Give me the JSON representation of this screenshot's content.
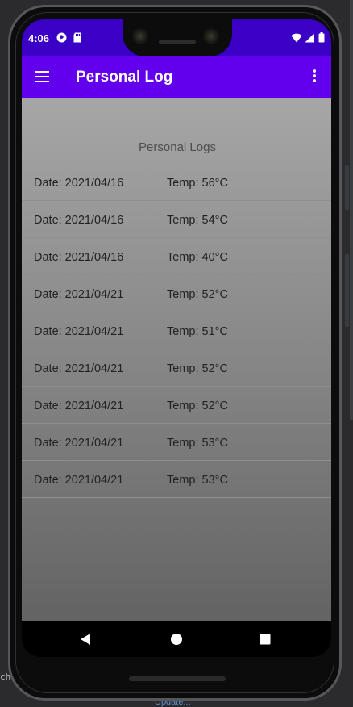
{
  "status_bar": {
    "time": "4:06",
    "left_icons": [
      "app-notification-icon",
      "sd-card-icon"
    ],
    "right_icons": [
      "wifi-icon",
      "cell-signal-icon",
      "battery-icon"
    ],
    "color": "#3a00c6"
  },
  "app_bar": {
    "title": "Personal Log",
    "color": "#6200ee",
    "menu_icon": "hamburger-menu-icon",
    "overflow_icon": "more-vertical-icon"
  },
  "content": {
    "section_title": "Personal Logs",
    "logs": [
      {
        "date": "Date: 2021/04/16",
        "temp": "Temp: 56°C"
      },
      {
        "date": "Date: 2021/04/16",
        "temp": "Temp: 54°C"
      },
      {
        "date": "Date: 2021/04/16",
        "temp": "Temp: 40°C"
      },
      {
        "date": "Date: 2021/04/21",
        "temp": "Temp: 52°C"
      },
      {
        "date": "Date: 2021/04/21",
        "temp": "Temp: 51°C"
      },
      {
        "date": "Date: 2021/04/21",
        "temp": "Temp: 52°C"
      },
      {
        "date": "Date: 2021/04/21",
        "temp": "Temp: 52°C"
      },
      {
        "date": "Date: 2021/04/21",
        "temp": "Temp: 53°C"
      },
      {
        "date": "Date: 2021/04/21",
        "temp": "Temp: 53°C"
      }
    ]
  },
  "nav_bar": {
    "buttons": [
      "back-icon",
      "home-icon",
      "recents-icon"
    ]
  },
  "ide_background": {
    "left_text": "ch:",
    "bottom_link": "Update..."
  }
}
